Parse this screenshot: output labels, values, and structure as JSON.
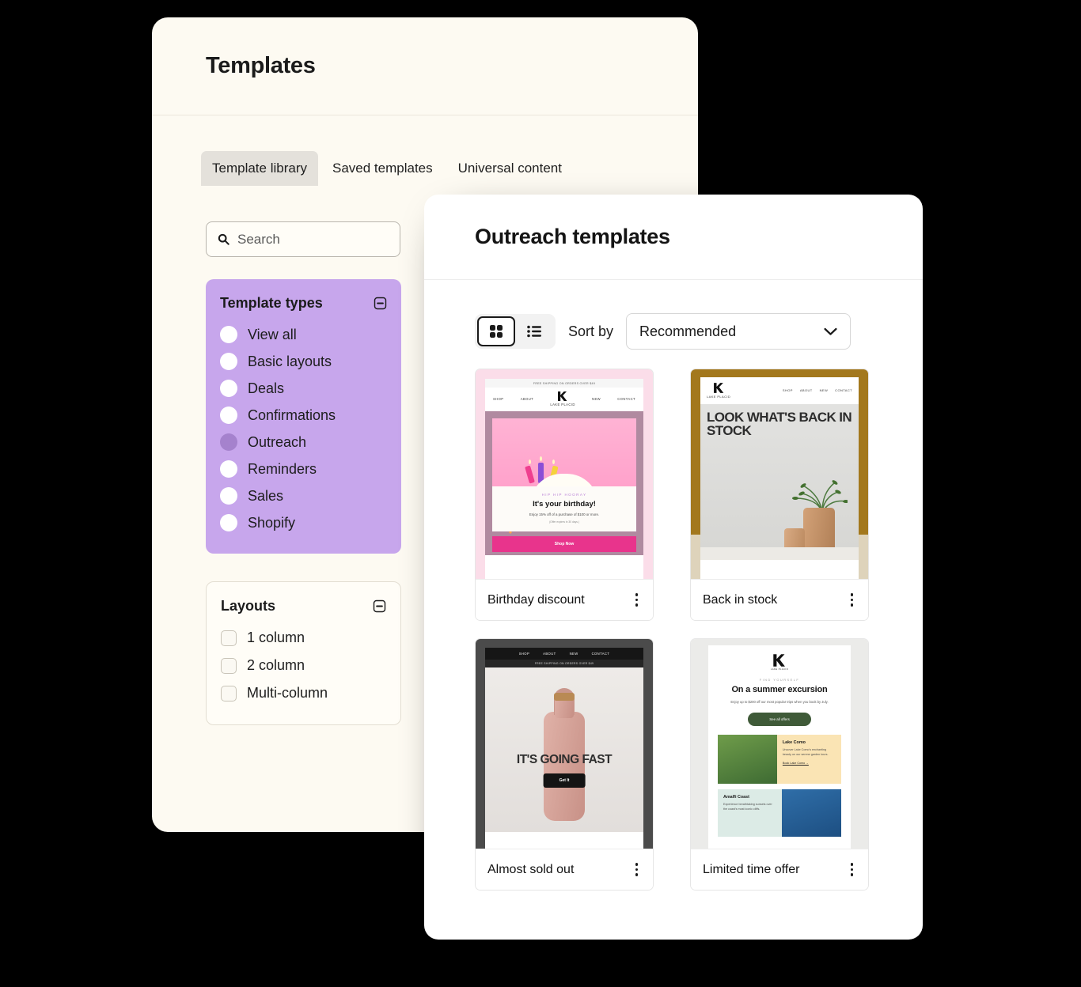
{
  "back_window": {
    "title": "Templates",
    "tabs": [
      {
        "label": "Template library",
        "active": true
      },
      {
        "label": "Saved templates",
        "active": false
      },
      {
        "label": "Universal content",
        "active": false
      }
    ],
    "search": {
      "placeholder": "Search",
      "value": "",
      "icon": "search-icon"
    },
    "filters": [
      {
        "title": "Template types",
        "collapse_icon": "minus-square-icon",
        "style": "purple",
        "control": "radio",
        "options": [
          {
            "label": "View all",
            "selected": false
          },
          {
            "label": "Basic layouts",
            "selected": false
          },
          {
            "label": "Deals",
            "selected": false
          },
          {
            "label": "Confirmations",
            "selected": false
          },
          {
            "label": "Outreach",
            "selected": true
          },
          {
            "label": "Reminders",
            "selected": false
          },
          {
            "label": "Sales",
            "selected": false
          },
          {
            "label": "Shopify",
            "selected": false
          }
        ]
      },
      {
        "title": "Layouts",
        "collapse_icon": "minus-square-icon",
        "style": "plain",
        "control": "checkbox",
        "options": [
          {
            "label": "1 column",
            "selected": false
          },
          {
            "label": "2 column",
            "selected": false
          },
          {
            "label": "Multi-column",
            "selected": false
          }
        ]
      }
    ]
  },
  "front_window": {
    "title": "Outreach templates",
    "toolbar": {
      "grid_view": {
        "icon": "grid-view-icon",
        "active": true
      },
      "list_view": {
        "icon": "list-view-icon",
        "active": false
      },
      "sort_label": "Sort by",
      "sort_value": "Recommended",
      "sort_chevron": "chevron-down-icon"
    },
    "cards": [
      {
        "name": "Birthday discount",
        "menu_icon": "kebab-menu-icon"
      },
      {
        "name": "Back in stock",
        "menu_icon": "kebab-menu-icon"
      },
      {
        "name": "Almost sold out",
        "menu_icon": "kebab-menu-icon"
      },
      {
        "name": "Limited time offer",
        "menu_icon": "kebab-menu-icon"
      }
    ],
    "previews": {
      "birthday": {
        "promo_bar": "FREE SHIPPING ON ORDERS OVER $49",
        "nav": [
          "SHOP",
          "ABOUT",
          "NEW",
          "CONTACT"
        ],
        "brand": "LAKE PLACID",
        "eyebrow": "HIP HIP HOORAY",
        "heading": "It's your birthday!",
        "body": "Enjoy 15% off of a purchase of $100 or more.",
        "fine_print": "(Offer expires in 30 days.)",
        "cta": "Shop Now"
      },
      "back_in_stock": {
        "nav": [
          "SHOP",
          "ABOUT",
          "NEW",
          "CONTACT"
        ],
        "brand": "LAKE PLACID",
        "heading": "LOOK WHAT'S BACK IN STOCK"
      },
      "almost_sold_out": {
        "nav": [
          "SHOP",
          "ABOUT",
          "NEW",
          "CONTACT"
        ],
        "promo_bar": "FREE SHIPPING ON ORDERS OVER $49",
        "heading": "IT'S GOING FAST",
        "cta": "Get It"
      },
      "limited_time_offer": {
        "brand": "LAKE PLACID",
        "eyebrow": "FIND YOURSELF",
        "heading": "On a summer excursion",
        "body": "Enjoy up to $200 off our most popular trips when you book by July.",
        "cta": "See all offers",
        "destinations": [
          {
            "title": "Lake Como",
            "body": "Uncover Lake Como's enchanting beauty on our serene garden tours.",
            "link": "Book Lake Como  →"
          },
          {
            "title": "Amalfi Coast",
            "body": "Experience breathtaking sunsets over the coast's most iconic cliffs."
          }
        ]
      }
    }
  },
  "colors": {
    "page_background": "#000000",
    "back_window_bg": "#fdfaf2",
    "front_window_bg": "#ffffff",
    "filter_accent": "#c7a6ec",
    "filter_selected": "#a582cd",
    "active_tab_bg": "#e4e1db"
  }
}
